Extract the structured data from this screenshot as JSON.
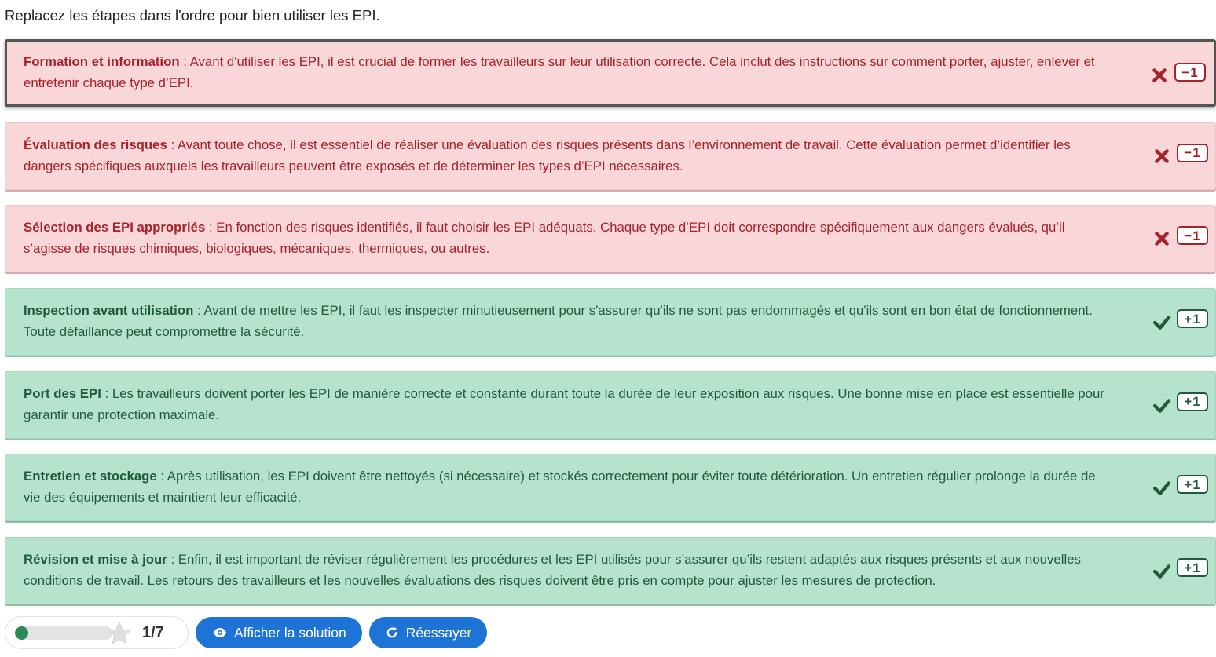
{
  "instructions": "Replacez les étapes dans l'ordre pour bien utiliser les EPI.",
  "colors": {
    "wrong_bg": "#f9d7d8",
    "wrong_text": "#a5222b",
    "right_bg": "#b6e3cd",
    "right_text": "#1e5b3c",
    "button_bg": "#1e73d6",
    "progress_fill": "#2d8a57"
  },
  "items": [
    {
      "title": "Formation et information",
      "text": " : Avant d'utiliser les EPI, il est crucial de former les travailleurs sur leur utilisation correcte. Cela inclut des instructions sur comment porter, ajuster, enlever et entretenir chaque type d’EPI.",
      "status": "wrong",
      "icon": "cross-icon",
      "score": "−1"
    },
    {
      "title": "Évaluation des risques",
      "text": " : Avant toute chose, il est essentiel de réaliser une évaluation des risques présents dans l’environnement de travail. Cette évaluation permet d’identifier les dangers spécifiques auxquels les travailleurs peuvent être exposés et de déterminer les types d’EPI nécessaires.",
      "status": "wrong",
      "icon": "cross-icon",
      "score": "−1"
    },
    {
      "title": "Sélection des EPI appropriés",
      "text": " : En fonction des risques identifiés, il faut choisir les EPI adéquats. Chaque type d’EPI doit correspondre spécifiquement aux dangers évalués, qu’il s’agisse de risques chimiques, biologiques, mécaniques, thermiques, ou autres.",
      "status": "wrong",
      "icon": "cross-icon",
      "score": "−1"
    },
    {
      "title": "Inspection avant utilisation",
      "text": " : Avant de mettre les EPI, il faut les inspecter minutieusement pour s'assurer qu'ils ne sont pas endommagés et qu'ils sont en bon état de fonctionnement. Toute défaillance peut compromettre la sécurité.",
      "status": "right",
      "icon": "check-icon",
      "score": "+1"
    },
    {
      "title": "Port des EPI",
      "text": " : Les travailleurs doivent porter les EPI de manière correcte et constante durant toute la durée de leur exposition aux risques. Une bonne mise en place est essentielle pour garantir une protection maximale.",
      "status": "right",
      "icon": "check-icon",
      "score": "+1"
    },
    {
      "title": "Entretien et stockage",
      "text": " : Après utilisation, les EPI doivent être nettoyés (si nécessaire) et stockés correctement pour éviter toute détérioration. Un entretien régulier prolonge la durée de vie des équipements et maintient leur efficacité.",
      "status": "right",
      "icon": "check-icon",
      "score": "+1"
    },
    {
      "title": "Révision et mise à jour",
      "text": " : Enfin, il est important de réviser régulièrement les procédures et les EPI utilisés pour s’assurer qu’ils restent adaptés aux risques présents et aux nouvelles conditions de travail. Les retours des travailleurs et les nouvelles évaluations des risques doivent être pris en compte pour ajuster les mesures de protection.",
      "status": "right",
      "icon": "check-icon",
      "score": "+1"
    }
  ],
  "footer": {
    "progress_fraction": 0.14,
    "score_text": "1/7",
    "star_icon": "star-icon",
    "show_solution_label": "Afficher la solution",
    "show_solution_icon": "eye-icon",
    "retry_label": "Réessayer",
    "retry_icon": "refresh-icon"
  }
}
